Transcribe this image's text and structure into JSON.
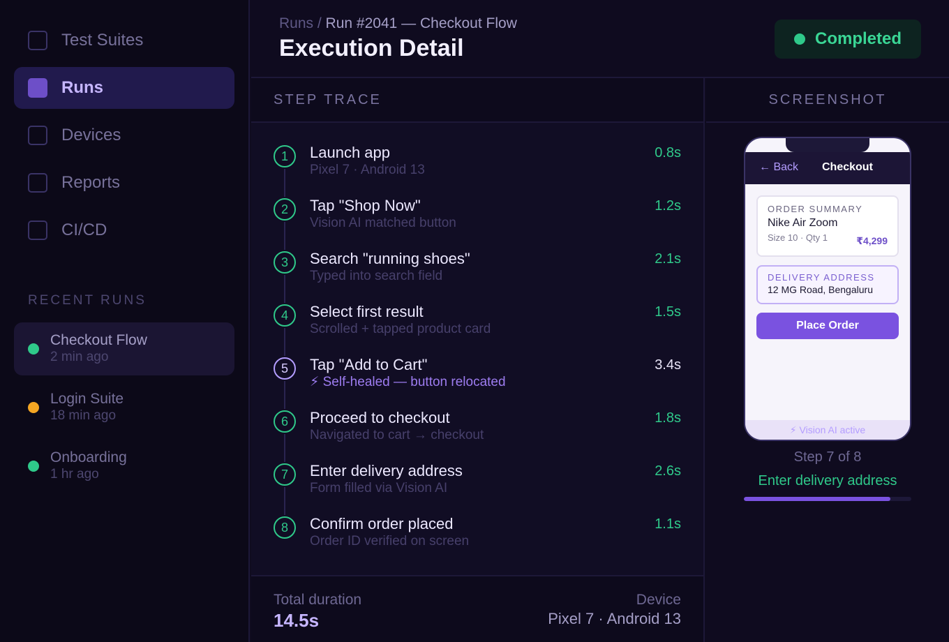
{
  "sidebar": {
    "nav": [
      {
        "label": "Test Suites",
        "active": false
      },
      {
        "label": "Runs",
        "active": true
      },
      {
        "label": "Devices",
        "active": false
      },
      {
        "label": "Reports",
        "active": false
      },
      {
        "label": "CI/CD",
        "active": false
      }
    ],
    "recent_title": "RECENT RUNS",
    "recent": [
      {
        "name": "Checkout Flow",
        "time": "2 min ago",
        "status_color": "#2fc98a",
        "active": true
      },
      {
        "name": "Login Suite",
        "time": "18 min ago",
        "status_color": "#f5a623",
        "active": false
      },
      {
        "name": "Onboarding",
        "time": "1 hr ago",
        "status_color": "#2fc98a",
        "active": false
      }
    ]
  },
  "header": {
    "breadcrumb_root": "Runs",
    "breadcrumb_sep": " / ",
    "breadcrumb_current": "Run #2041 — Checkout Flow",
    "title": "Execution Detail",
    "status": "Completed",
    "status_color": "#2fc98a"
  },
  "trace": {
    "title": "STEP TRACE",
    "steps": [
      {
        "num": "1",
        "title": "Launch app",
        "sub": "Pixel 7 · Android 13",
        "time": "0.8s",
        "healed": false
      },
      {
        "num": "2",
        "title": "Tap \"Shop Now\"",
        "sub": "Vision AI matched button",
        "time": "1.2s",
        "healed": false
      },
      {
        "num": "3",
        "title": "Search \"running shoes\"",
        "sub": "Typed into search field",
        "time": "2.1s",
        "healed": false
      },
      {
        "num": "4",
        "title": "Select first result",
        "sub": "Scrolled + tapped product card",
        "time": "1.5s",
        "healed": false
      },
      {
        "num": "5",
        "title": "Tap \"Add to Cart\"",
        "sub": "⚡ Self-healed — button relocated",
        "time": "3.4s",
        "healed": true
      },
      {
        "num": "6",
        "title": "Proceed to checkout",
        "sub": "Navigated to cart → checkout",
        "time": "1.8s",
        "healed": false
      },
      {
        "num": "7",
        "title": "Enter delivery address",
        "sub": "Form filled via Vision AI",
        "time": "2.6s",
        "healed": false
      },
      {
        "num": "8",
        "title": "Confirm order placed",
        "sub": "Order ID verified on screen",
        "time": "1.1s",
        "healed": false
      }
    ],
    "footer": {
      "duration_label": "Total duration",
      "duration_value": "14.5s",
      "device_label": "Device",
      "device_value": "Pixel 7 · Android 13"
    }
  },
  "screenshot": {
    "title": "SCREENSHOT",
    "phone": {
      "back": "← Back",
      "screen_title": "Checkout",
      "summary_label": "ORDER SUMMARY",
      "product": "Nike Air Zoom",
      "product_meta": "Size 10 · Qty 1",
      "price": "₹4,299",
      "address_label": "DELIVERY ADDRESS",
      "address": "12 MG Road, Bengaluru",
      "cta": "Place Order",
      "footer": "⚡ Vision AI active"
    },
    "step_counter": "Step 7 of 8",
    "step_current": "Enter delivery address",
    "progress": 0.875
  },
  "colors": {
    "accent": "#7a52e0",
    "success": "#2fc98a",
    "warning": "#f5a623"
  }
}
